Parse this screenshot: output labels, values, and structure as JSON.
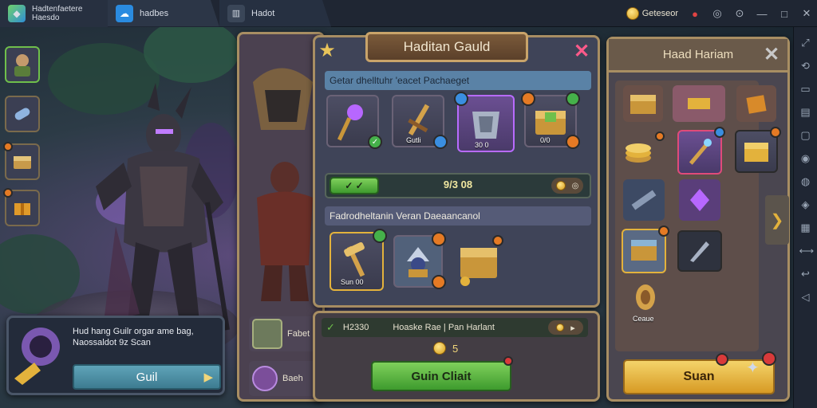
{
  "tabs": [
    {
      "label": "Hadtenfaetere\nHaesdo"
    },
    {
      "label": "hadbes"
    },
    {
      "label": "Hadot"
    }
  ],
  "topbar": {
    "account": "Geteseor"
  },
  "left_ad": {
    "text": "Hud hang Guilr orgar ame bag, Naossaldot 9z Scan",
    "button": "Guil"
  },
  "guild": {
    "title": "Haditan Gauld",
    "section1": "Getar dhelltuhr 'eacet Pachaeget",
    "items": [
      {
        "label": ""
      },
      {
        "label": "Gutli"
      },
      {
        "label": "30 0"
      },
      {
        "label": "0/0"
      }
    ],
    "bar_value": "9/3 08",
    "section2": "Fadrodheltanin Veran Daeaancanol",
    "items2": [
      {
        "label": "Sun 00"
      }
    ]
  },
  "purchase": {
    "code": "H2330",
    "text": "Hoaske Rae | Pan Harlant",
    "price": "5",
    "button": "Guin Cliait"
  },
  "side_rows": [
    {
      "label": "Fabet"
    },
    {
      "label": "Baeh"
    }
  ],
  "right_panel": {
    "title": "Haad Hariam",
    "item_label": "Ceaue",
    "button": "Suan"
  },
  "colors": {
    "accent_green": "#6fbf4b",
    "gold": "#e3b23c",
    "panel_border": "#a88e63"
  }
}
